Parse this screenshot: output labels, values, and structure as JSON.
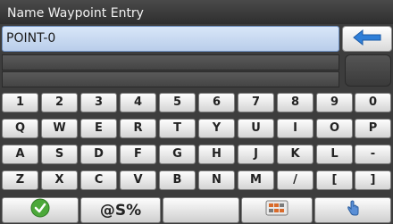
{
  "window": {
    "title": "Name Waypoint Entry"
  },
  "entry": {
    "value": "POINT-0"
  },
  "backspace_icon": "back-arrow-icon",
  "keyboard": {
    "rows": [
      [
        "1",
        "2",
        "3",
        "4",
        "5",
        "6",
        "7",
        "8",
        "9",
        "0"
      ],
      [
        "Q",
        "W",
        "E",
        "R",
        "T",
        "Y",
        "U",
        "I",
        "O",
        "P"
      ],
      [
        "A",
        "S",
        "D",
        "F",
        "G",
        "H",
        "J",
        "K",
        "L",
        "-"
      ],
      [
        "Z",
        "X",
        "C",
        "V",
        "B",
        "N",
        "M",
        "/",
        "[",
        "]"
      ]
    ]
  },
  "bottom_bar": {
    "symbols_label": "@S%",
    "ok_icon": "checkmark-icon",
    "layout_icon": "keyboard-layout-icon",
    "touch_icon": "finger-tap-icon"
  },
  "colors": {
    "accent": "#2f7fd8",
    "ok_green": "#4ca83a",
    "field_bg": "#c8d9f2"
  }
}
